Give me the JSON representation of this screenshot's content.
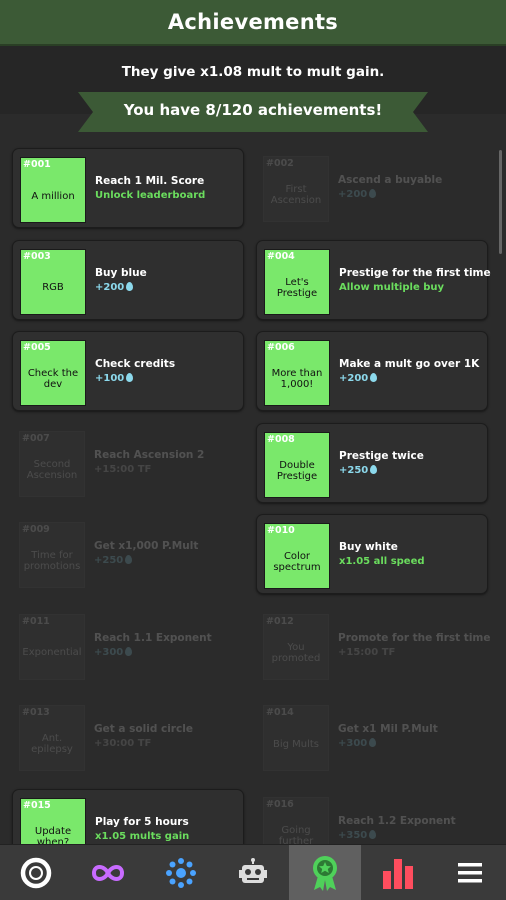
{
  "header": {
    "title": "Achievements"
  },
  "info": "They give x1.08 mult to mult gain.",
  "banner": "You have 8/120 achievements!",
  "achievements": [
    {
      "num": "#001",
      "name": "A million",
      "desc": "Reach 1 Mil. Score",
      "reward": "Unlock leaderboard",
      "reward_type": "green",
      "unlocked": true
    },
    {
      "num": "#002",
      "name": "First Ascension",
      "desc": "Ascend a buyable",
      "reward": "+200",
      "reward_type": "drop",
      "unlocked": false
    },
    {
      "num": "#003",
      "name": "RGB",
      "desc": "Buy blue",
      "reward": "+200",
      "reward_type": "drop",
      "unlocked": true
    },
    {
      "num": "#004",
      "name": "Let's Prestige",
      "desc": "Prestige for the first time",
      "reward": "Allow multiple buy",
      "reward_type": "green",
      "unlocked": true
    },
    {
      "num": "#005",
      "name": "Check the dev",
      "desc": "Check credits",
      "reward": "+100",
      "reward_type": "drop",
      "unlocked": true
    },
    {
      "num": "#006",
      "name": "More than 1,000!",
      "desc": "Make a mult go over 1K",
      "reward": "+200",
      "reward_type": "drop",
      "unlocked": true
    },
    {
      "num": "#007",
      "name": "Second Ascension",
      "desc": "Reach Ascension 2",
      "reward": "+15:00 TF",
      "reward_type": "gray",
      "unlocked": false
    },
    {
      "num": "#008",
      "name": "Double Prestige",
      "desc": "Prestige twice",
      "reward": "+250",
      "reward_type": "drop",
      "unlocked": true
    },
    {
      "num": "#009",
      "name": "Time for promotions",
      "desc": "Get x1,000 P.Mult",
      "reward": "+250",
      "reward_type": "drop",
      "unlocked": false
    },
    {
      "num": "#010",
      "name": "Color spectrum",
      "desc": "Buy white",
      "reward": "x1.05 all speed",
      "reward_type": "green",
      "unlocked": true
    },
    {
      "num": "#011",
      "name": "Exponential",
      "desc": "Reach 1.1 Exponent",
      "reward": "+300",
      "reward_type": "drop",
      "unlocked": false
    },
    {
      "num": "#012",
      "name": "You promoted",
      "desc": "Promote for the first time",
      "reward": "+15:00 TF",
      "reward_type": "gray",
      "unlocked": false
    },
    {
      "num": "#013",
      "name": "Ant. epilepsy",
      "desc": "Get a solid circle",
      "reward": "+30:00 TF",
      "reward_type": "gray",
      "unlocked": false
    },
    {
      "num": "#014",
      "name": "Big Mults",
      "desc": "Get x1 Mil P.Mult",
      "reward": "+300",
      "reward_type": "drop",
      "unlocked": false
    },
    {
      "num": "#015",
      "name": "Update when?",
      "desc": "Play for 5 hours",
      "reward": "x1.05 mults gain",
      "reward_type": "green",
      "unlocked": true
    },
    {
      "num": "#016",
      "name": "Going further",
      "desc": "Reach 1.2 Exponent",
      "reward": "+350",
      "reward_type": "drop",
      "unlocked": false
    }
  ],
  "nav": [
    {
      "icon": "ring-icon",
      "color": "#ffffff"
    },
    {
      "icon": "infinity-icon",
      "color": "#c86bff"
    },
    {
      "icon": "atom-icon",
      "color": "#4aa3ff"
    },
    {
      "icon": "robot-icon",
      "color": "#dddddd"
    },
    {
      "icon": "medal-icon",
      "color": "#4fd15a",
      "active": true
    },
    {
      "icon": "bar-chart-icon",
      "color": "#ff4d5e"
    },
    {
      "icon": "menu-icon",
      "color": "#ffffff"
    }
  ]
}
